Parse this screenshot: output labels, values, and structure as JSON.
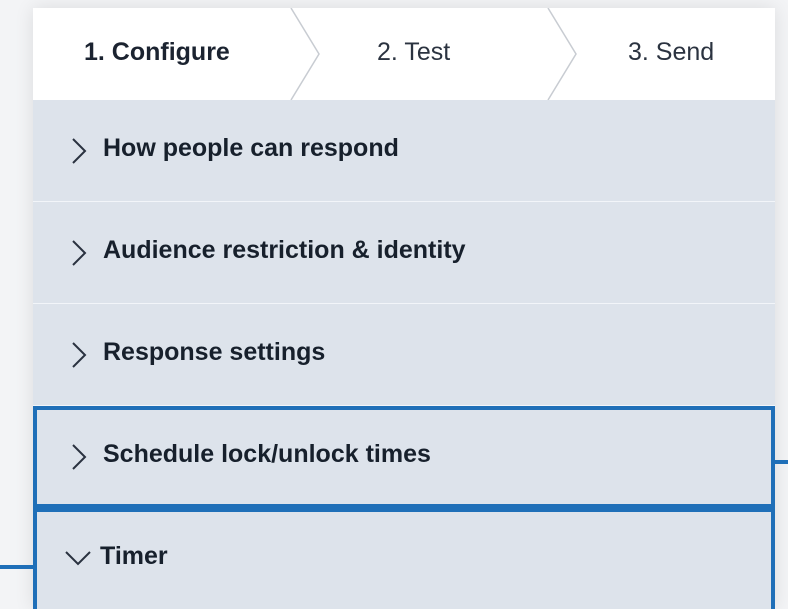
{
  "steps": [
    {
      "label": "1. Configure",
      "active": true
    },
    {
      "label": "2. Test",
      "active": false
    },
    {
      "label": "3. Send",
      "active": false
    }
  ],
  "sections": [
    {
      "label": "How people can respond",
      "expanded": false,
      "icon": "chevron-right-icon"
    },
    {
      "label": "Audience restriction & identity",
      "expanded": false,
      "icon": "chevron-right-icon"
    },
    {
      "label": "Response settings",
      "expanded": false,
      "icon": "chevron-right-icon"
    },
    {
      "label": "Schedule lock/unlock times",
      "expanded": false,
      "icon": "chevron-right-icon",
      "highlighted": true
    },
    {
      "label": "Timer",
      "expanded": true,
      "icon": "chevron-down-icon",
      "highlighted": true
    }
  ],
  "colors": {
    "highlight": "#1f6fb8",
    "panel_bg": "#dde3eb",
    "tabs_bg": "#ffffff"
  }
}
